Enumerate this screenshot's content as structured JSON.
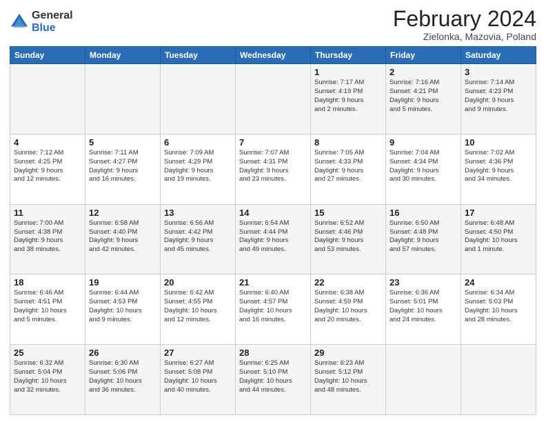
{
  "header": {
    "logo_general": "General",
    "logo_blue": "Blue",
    "title": "February 2024",
    "subtitle": "Zielonka, Mazovia, Poland"
  },
  "days_of_week": [
    "Sunday",
    "Monday",
    "Tuesday",
    "Wednesday",
    "Thursday",
    "Friday",
    "Saturday"
  ],
  "weeks": [
    [
      {
        "day": "",
        "info": ""
      },
      {
        "day": "",
        "info": ""
      },
      {
        "day": "",
        "info": ""
      },
      {
        "day": "",
        "info": ""
      },
      {
        "day": "1",
        "info": "Sunrise: 7:17 AM\nSunset: 4:19 PM\nDaylight: 9 hours\nand 2 minutes."
      },
      {
        "day": "2",
        "info": "Sunrise: 7:16 AM\nSunset: 4:21 PM\nDaylight: 9 hours\nand 5 minutes."
      },
      {
        "day": "3",
        "info": "Sunrise: 7:14 AM\nSunset: 4:23 PM\nDaylight: 9 hours\nand 9 minutes."
      }
    ],
    [
      {
        "day": "4",
        "info": "Sunrise: 7:12 AM\nSunset: 4:25 PM\nDaylight: 9 hours\nand 12 minutes."
      },
      {
        "day": "5",
        "info": "Sunrise: 7:11 AM\nSunset: 4:27 PM\nDaylight: 9 hours\nand 16 minutes."
      },
      {
        "day": "6",
        "info": "Sunrise: 7:09 AM\nSunset: 4:29 PM\nDaylight: 9 hours\nand 19 minutes."
      },
      {
        "day": "7",
        "info": "Sunrise: 7:07 AM\nSunset: 4:31 PM\nDaylight: 9 hours\nand 23 minutes."
      },
      {
        "day": "8",
        "info": "Sunrise: 7:05 AM\nSunset: 4:33 PM\nDaylight: 9 hours\nand 27 minutes."
      },
      {
        "day": "9",
        "info": "Sunrise: 7:04 AM\nSunset: 4:34 PM\nDaylight: 9 hours\nand 30 minutes."
      },
      {
        "day": "10",
        "info": "Sunrise: 7:02 AM\nSunset: 4:36 PM\nDaylight: 9 hours\nand 34 minutes."
      }
    ],
    [
      {
        "day": "11",
        "info": "Sunrise: 7:00 AM\nSunset: 4:38 PM\nDaylight: 9 hours\nand 38 minutes."
      },
      {
        "day": "12",
        "info": "Sunrise: 6:58 AM\nSunset: 4:40 PM\nDaylight: 9 hours\nand 42 minutes."
      },
      {
        "day": "13",
        "info": "Sunrise: 6:56 AM\nSunset: 4:42 PM\nDaylight: 9 hours\nand 45 minutes."
      },
      {
        "day": "14",
        "info": "Sunrise: 6:54 AM\nSunset: 4:44 PM\nDaylight: 9 hours\nand 49 minutes."
      },
      {
        "day": "15",
        "info": "Sunrise: 6:52 AM\nSunset: 4:46 PM\nDaylight: 9 hours\nand 53 minutes."
      },
      {
        "day": "16",
        "info": "Sunrise: 6:50 AM\nSunset: 4:48 PM\nDaylight: 9 hours\nand 57 minutes."
      },
      {
        "day": "17",
        "info": "Sunrise: 6:48 AM\nSunset: 4:50 PM\nDaylight: 10 hours\nand 1 minute."
      }
    ],
    [
      {
        "day": "18",
        "info": "Sunrise: 6:46 AM\nSunset: 4:51 PM\nDaylight: 10 hours\nand 5 minutes."
      },
      {
        "day": "19",
        "info": "Sunrise: 6:44 AM\nSunset: 4:53 PM\nDaylight: 10 hours\nand 9 minutes."
      },
      {
        "day": "20",
        "info": "Sunrise: 6:42 AM\nSunset: 4:55 PM\nDaylight: 10 hours\nand 12 minutes."
      },
      {
        "day": "21",
        "info": "Sunrise: 6:40 AM\nSunset: 4:57 PM\nDaylight: 10 hours\nand 16 minutes."
      },
      {
        "day": "22",
        "info": "Sunrise: 6:38 AM\nSunset: 4:59 PM\nDaylight: 10 hours\nand 20 minutes."
      },
      {
        "day": "23",
        "info": "Sunrise: 6:36 AM\nSunset: 5:01 PM\nDaylight: 10 hours\nand 24 minutes."
      },
      {
        "day": "24",
        "info": "Sunrise: 6:34 AM\nSunset: 5:03 PM\nDaylight: 10 hours\nand 28 minutes."
      }
    ],
    [
      {
        "day": "25",
        "info": "Sunrise: 6:32 AM\nSunset: 5:04 PM\nDaylight: 10 hours\nand 32 minutes."
      },
      {
        "day": "26",
        "info": "Sunrise: 6:30 AM\nSunset: 5:06 PM\nDaylight: 10 hours\nand 36 minutes."
      },
      {
        "day": "27",
        "info": "Sunrise: 6:27 AM\nSunset: 5:08 PM\nDaylight: 10 hours\nand 40 minutes."
      },
      {
        "day": "28",
        "info": "Sunrise: 6:25 AM\nSunset: 5:10 PM\nDaylight: 10 hours\nand 44 minutes."
      },
      {
        "day": "29",
        "info": "Sunrise: 6:23 AM\nSunset: 5:12 PM\nDaylight: 10 hours\nand 48 minutes."
      },
      {
        "day": "",
        "info": ""
      },
      {
        "day": "",
        "info": ""
      }
    ]
  ]
}
